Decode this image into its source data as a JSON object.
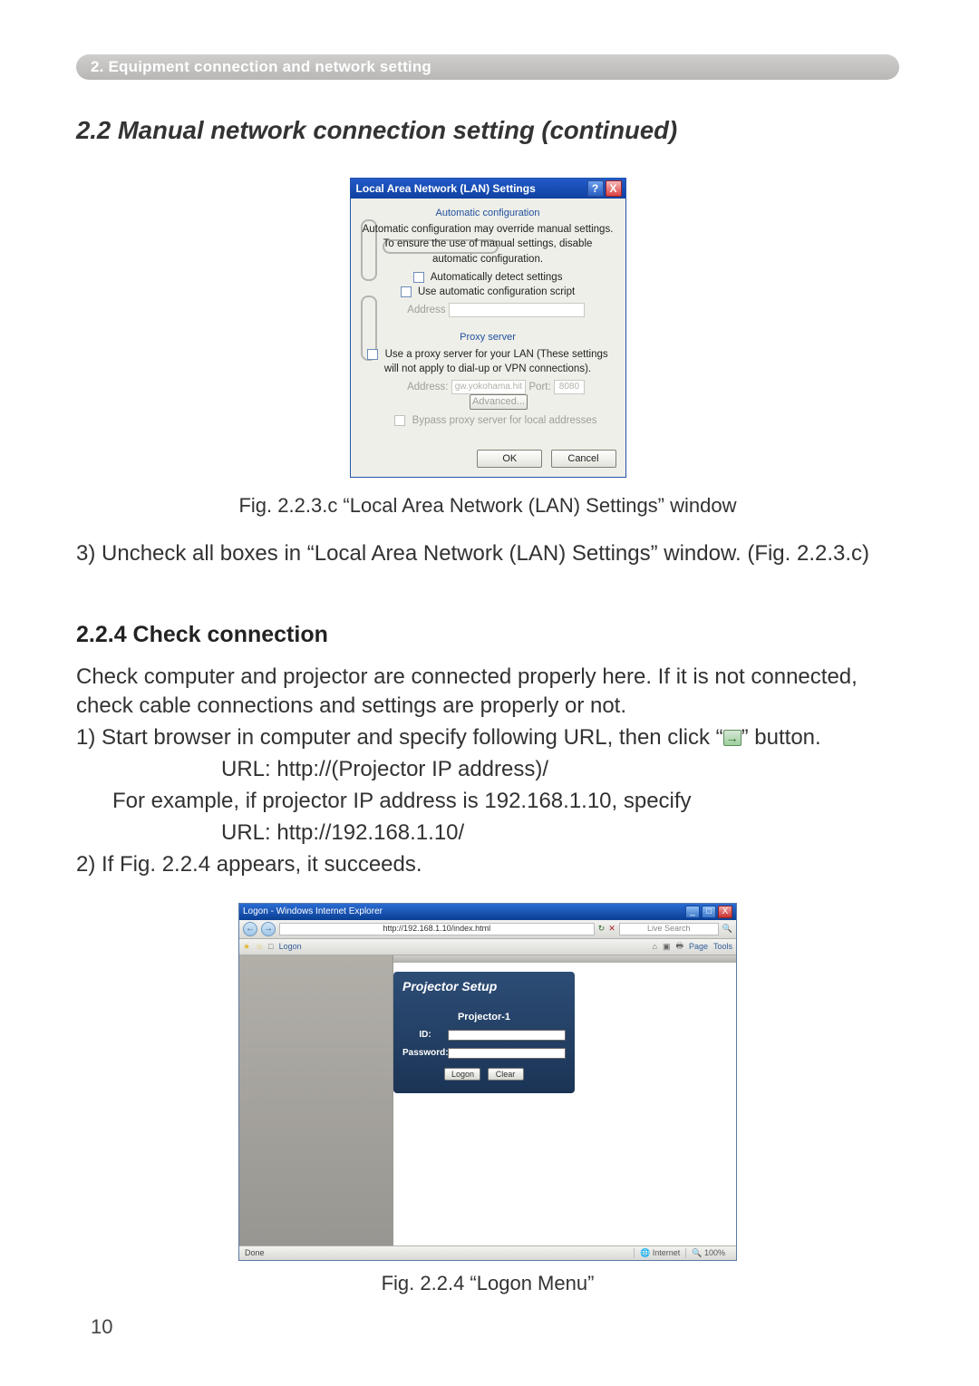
{
  "crumb": "2. Equipment connection and network setting",
  "heading_cont": "2.2 Manual network connection setting (continued)",
  "lan_dialog": {
    "title": "Local Area Network (LAN) Settings",
    "help_btn": "?",
    "close_btn": "X",
    "auto_group_label": "Automatic configuration",
    "auto_desc": "Automatic configuration may override manual settings.  To ensure the use of manual settings, disable automatic configuration.",
    "auto_detect_label": "Automatically detect settings",
    "auto_script_label": "Use automatic configuration script",
    "address_label": "Address",
    "proxy_group_label": "Proxy server",
    "proxy_use_label": "Use a proxy server for your LAN (These settings will not apply to dial-up or VPN connections).",
    "proxy_addr_label": "Address:",
    "proxy_addr_value": "gw.yokohama.hit",
    "proxy_port_label": "Port:",
    "proxy_port_value": "8080",
    "advanced_btn": "Advanced...",
    "bypass_label": "Bypass proxy server for local addresses",
    "ok_btn": "OK",
    "cancel_btn": "Cancel"
  },
  "fig1_caption": "Fig. 2.2.3.c “Local Area Network (LAN) Settings” window",
  "step3": "3) Uncheck all boxes in “Local Area Network (LAN) Settings” window. (Fig. 2.2.3.c)",
  "sub_heading": "2.2.4 Check connection",
  "p1": "Check computer and projector are connected properly here. If it is not connected, check cable connections and settings are properly or not.",
  "p2_a": "1) Start browser in computer and specify following URL, then click “",
  "p2_b": "” button.",
  "url_line1": "URL: http://(Projector IP address)/",
  "p3": "For example, if projector IP address is 192.168.1.10, specify",
  "url_line2": "URL: http://192.168.1.10/",
  "p4": "2) If Fig. 2.2.4 appears, it succeeds.",
  "ie": {
    "title": "Logon - Windows Internet Explorer",
    "min_btn": "_",
    "max_btn": "□",
    "close_btn": "X",
    "url": "http://192.168.1.10/index.html",
    "search_placeholder": "Live Search",
    "tab_label": "Logon",
    "tool_page": "Page",
    "tool_tools": "Tools",
    "panel_title": "Projector Setup",
    "panel_sub": "Projector-1",
    "id_label": "ID:",
    "pw_label": "Password:",
    "logon_btn": "Logon",
    "clear_btn": "Clear",
    "status_done": "Done",
    "status_zone": "Internet",
    "status_zoom": "100%"
  },
  "fig2_caption": "Fig. 2.2.4  “Logon Menu”",
  "page_number": "10"
}
